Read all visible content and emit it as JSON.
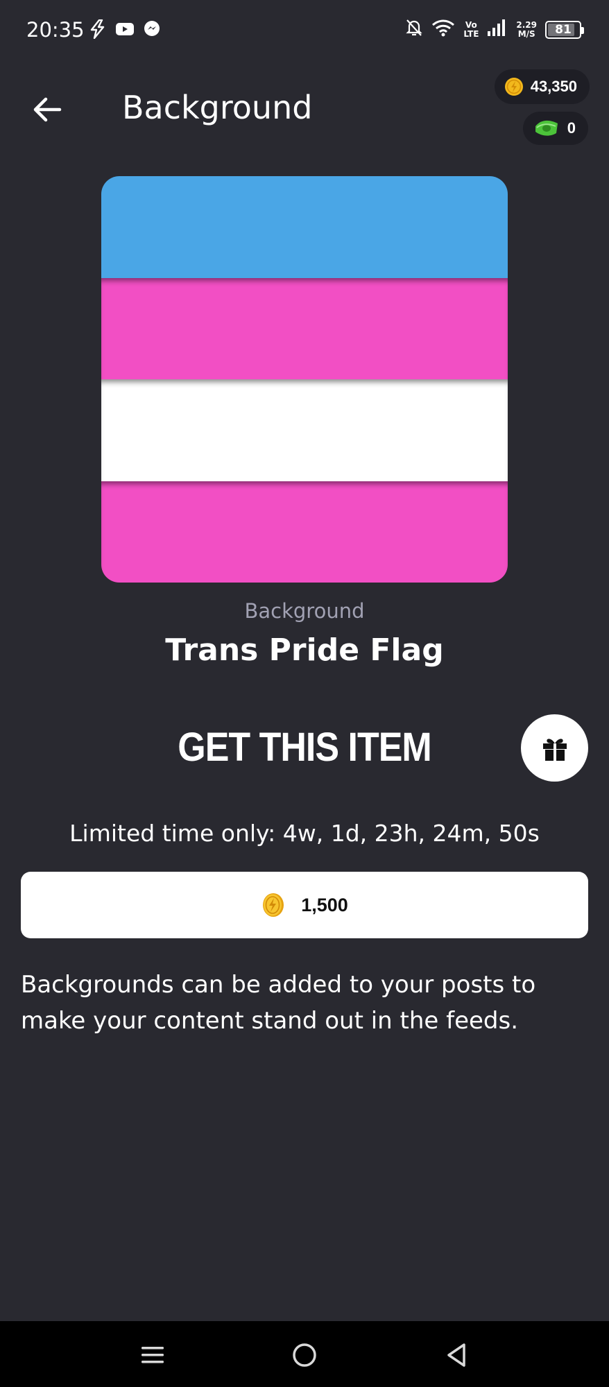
{
  "status_bar": {
    "time": "20:35",
    "network_top": "Vo",
    "network_bottom": "LTE",
    "speed_top": "2.29",
    "speed_bottom": "M/S",
    "battery": "81",
    "battery_level": 0.81
  },
  "header": {
    "title": "Background",
    "coins": "43,350",
    "cash": "0"
  },
  "item": {
    "category": "Background",
    "name": "Trans Pride Flag",
    "stripe_colors": [
      "#4aa6e6",
      "#f24fc4",
      "#ffffff",
      "#f24fc4"
    ]
  },
  "purchase": {
    "heading": "GET THIS ITEM",
    "limited_time": "Limited time only: 4w, 1d, 23h, 24m, 50s",
    "price": "1,500"
  },
  "description": "Backgrounds can be added to your posts to make your content stand out in the feeds.",
  "colors": {
    "background": "#292930",
    "pill_background": "#1e1e25",
    "coin_gold": "#f2b81c",
    "cash_green": "#4cc33a"
  },
  "icons": {
    "back": "arrow-left-icon",
    "coin": "coin-icon",
    "cash": "cash-icon",
    "gift": "gift-icon",
    "nav_menu": "menu-icon",
    "nav_home": "home-circle-icon",
    "nav_back": "back-triangle-icon"
  }
}
